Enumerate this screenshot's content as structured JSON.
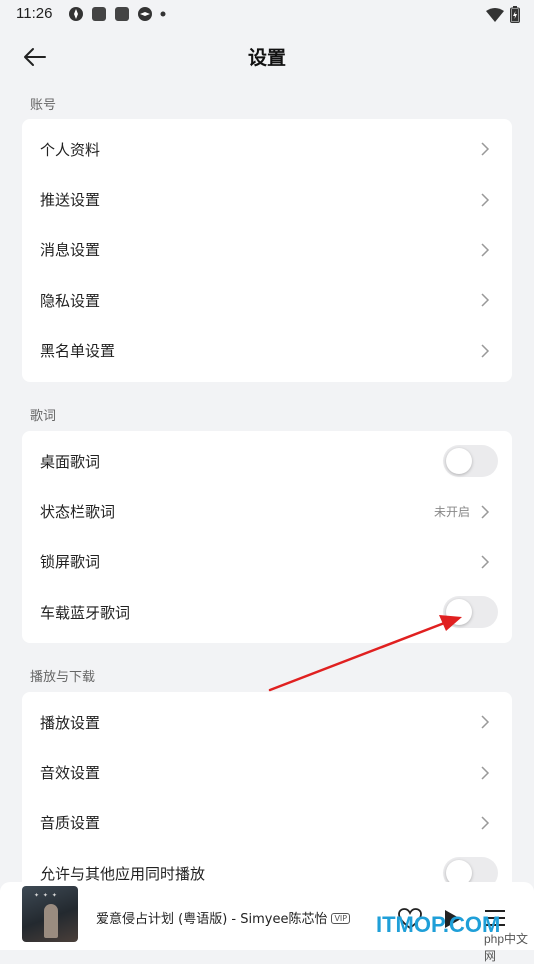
{
  "status_bar": {
    "time": "11:26",
    "icons": [
      "app-notification-icon",
      "app-square-icon",
      "app-square-icon",
      "app-notification-icon",
      "dot-icon",
      "wifi-icon",
      "battery-icon"
    ]
  },
  "header": {
    "title": "设置",
    "back_icon": "arrow-left-icon"
  },
  "sections": [
    {
      "label": "账号",
      "items": [
        {
          "label": "个人资料",
          "control": "chevron"
        },
        {
          "label": "推送设置",
          "control": "chevron"
        },
        {
          "label": "消息设置",
          "control": "chevron"
        },
        {
          "label": "隐私设置",
          "control": "chevron"
        },
        {
          "label": "黑名单设置",
          "control": "chevron"
        }
      ]
    },
    {
      "label": "歌词",
      "items": [
        {
          "label": "桌面歌词",
          "control": "toggle",
          "on": false
        },
        {
          "label": "状态栏歌词",
          "control": "chevron",
          "value": "未开启"
        },
        {
          "label": "锁屏歌词",
          "control": "chevron"
        },
        {
          "label": "车载蓝牙歌词",
          "control": "toggle",
          "on": false
        }
      ]
    },
    {
      "label": "播放与下载",
      "items": [
        {
          "label": "播放设置",
          "control": "chevron"
        },
        {
          "label": "音效设置",
          "control": "chevron"
        },
        {
          "label": "音质设置",
          "control": "chevron"
        },
        {
          "label": "允许与其他应用同时播放",
          "control": "toggle",
          "on": false
        }
      ]
    }
  ],
  "player": {
    "track": "爱意侵占计划 (粤语版) - Simyee陈芯怡",
    "badge": "VIP",
    "buttons": [
      "heart-icon",
      "play-icon",
      "playlist-icon"
    ]
  },
  "watermark": {
    "text": "ITMOP.COM",
    "sub": "php中文网"
  },
  "colors": {
    "background": "#f2f3f5",
    "card": "#ffffff",
    "annotation_arrow": "#e02020",
    "watermark": "#1f9fd8"
  }
}
